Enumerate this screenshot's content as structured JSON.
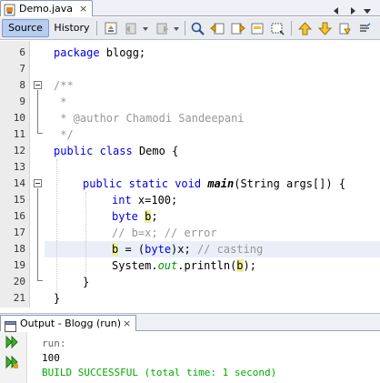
{
  "file_tab": {
    "label": "Demo.java",
    "close": "×"
  },
  "toolbar": {
    "source_label": "Source",
    "history_label": "History"
  },
  "editor": {
    "line_numbers": [
      "6",
      "7",
      "8",
      "9",
      "10",
      "11",
      "12",
      "13",
      "14",
      "15",
      "16",
      "17",
      "18",
      "19",
      "20",
      "21"
    ],
    "lines": {
      "l6": {
        "kw": "package",
        "rest": " blogg;"
      },
      "l8": "/**",
      "l9": " *",
      "l10": " * @author Chamodi Sandeepani",
      "l11": " */",
      "l12": {
        "kw1": "public",
        "kw2": "class",
        "rest": " Demo {"
      },
      "l14": {
        "kw1": "public",
        "kw2": "static",
        "kw3": "void",
        "method": "main",
        "rest": "(String args[]) {"
      },
      "l15": {
        "kw": "int",
        "rest": " x=100;"
      },
      "l16": {
        "kw": "byte",
        "var": "b",
        "rest": ";"
      },
      "l17": "// b=x; // error",
      "l18": {
        "var": "b",
        "mid1": " = (",
        "kw": "byte",
        "mid2": ")x; ",
        "comment": "// casting"
      },
      "l19": {
        "pre": "System.",
        "field": "out",
        "mid": ".println(",
        "var": "b",
        "post": ");"
      },
      "l20": "}",
      "l21": "}"
    }
  },
  "output": {
    "tab_label": "Output - Blogg (run)",
    "close": "×",
    "lines": [
      "run:",
      "100",
      "BUILD SUCCESSFUL (total time: 1 second)"
    ],
    "colors": {
      "normal": "#000000",
      "dim": "#666666",
      "success": "#00aa00"
    }
  }
}
